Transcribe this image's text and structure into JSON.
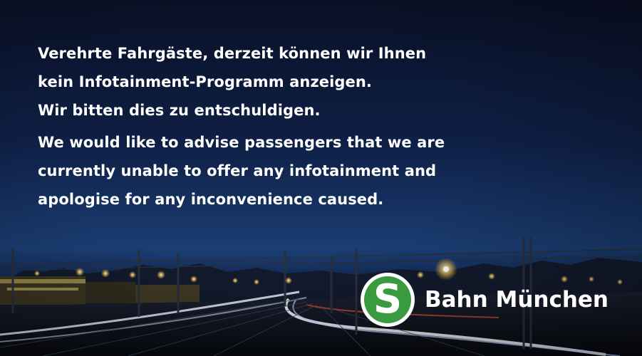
{
  "message": {
    "german": [
      "Verehrte Fahrgäste, derzeit können wir Ihnen",
      "kein Infotainment-Programm anzeigen.",
      "Wir bitten dies zu entschuldigen."
    ],
    "english": [
      "We would like to advise passengers that we are",
      "currently unable to offer any infotainment and",
      "apologise for any inconvenience caused."
    ]
  },
  "logo": {
    "letter": "S",
    "text": "Bahn München",
    "badge_color": "#3a9a40"
  },
  "colors": {
    "text": "#ffffff",
    "sky_top": "#0a1026",
    "sky_horizon": "#1a3e73"
  }
}
